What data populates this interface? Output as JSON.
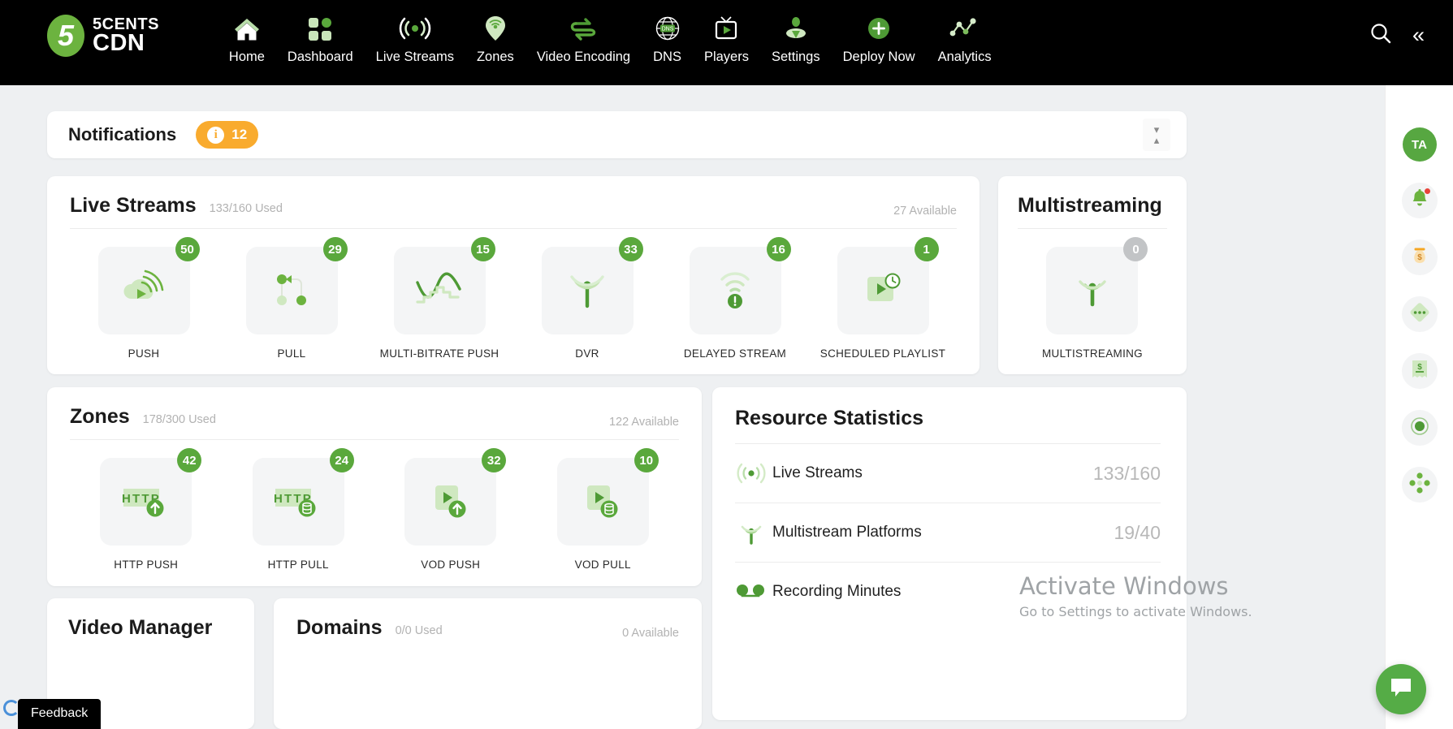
{
  "brand": {
    "mark": "5",
    "line1": "5CENTS",
    "line2": "CDN"
  },
  "nav": {
    "items": [
      {
        "label": "Home",
        "icon": "home-icon"
      },
      {
        "label": "Dashboard",
        "icon": "grid-icon"
      },
      {
        "label": "Live Streams",
        "icon": "broadcast-icon"
      },
      {
        "label": "Zones",
        "icon": "map-pin-wifi-icon"
      },
      {
        "label": "Video Encoding",
        "icon": "transcode-arrows-icon"
      },
      {
        "label": "DNS",
        "icon": "globe-dns-icon"
      },
      {
        "label": "Players",
        "icon": "tv-play-icon"
      },
      {
        "label": "Settings",
        "icon": "user-gear-icon"
      },
      {
        "label": "Deploy Now",
        "icon": "plus-circle-icon"
      },
      {
        "label": "Analytics",
        "icon": "line-chart-icon"
      }
    ],
    "search_icon": "search-icon",
    "collapse_icon": "double-chevron-left-icon",
    "collapse_glyph": "«"
  },
  "notifications": {
    "title": "Notifications",
    "count": "12",
    "info_glyph": "i"
  },
  "live_streams": {
    "title": "Live Streams",
    "used": "133/160 Used",
    "available": "27 Available",
    "tiles": [
      {
        "label": "PUSH",
        "count": "50",
        "icon": "cloud-upload-play-icon"
      },
      {
        "label": "PULL",
        "count": "29",
        "icon": "pull-nodes-icon"
      },
      {
        "label": "MULTI-BITRATE PUSH",
        "count": "15",
        "icon": "bitrate-wave-icon"
      },
      {
        "label": "DVR",
        "count": "33",
        "icon": "dvr-broadcast-icon"
      },
      {
        "label": "DELAYED STREAM",
        "count": "16",
        "icon": "delayed-wifi-alert-icon"
      },
      {
        "label": "SCHEDULED PLAYLIST",
        "count": "1",
        "icon": "play-clock-icon"
      }
    ]
  },
  "multistreaming": {
    "title": "Multistreaming",
    "tiles": [
      {
        "label": "MULTISTREAMING",
        "count": "0",
        "icon": "multistream-broadcast-icon"
      }
    ]
  },
  "zones": {
    "title": "Zones",
    "used": "178/300 Used",
    "available": "122 Available",
    "tiles": [
      {
        "label": "HTTP PUSH",
        "count": "42",
        "icon": "http-upload-icon"
      },
      {
        "label": "HTTP PULL",
        "count": "24",
        "icon": "http-database-icon"
      },
      {
        "label": "VOD PUSH",
        "count": "32",
        "icon": "vod-upload-icon"
      },
      {
        "label": "VOD PULL",
        "count": "10",
        "icon": "vod-database-icon"
      }
    ]
  },
  "resource_statistics": {
    "title": "Resource Statistics",
    "rows": [
      {
        "label": "Live Streams",
        "value": "133/160",
        "icon": "broadcast-icon"
      },
      {
        "label": "Multistream Platforms",
        "value": "19/40",
        "icon": "multistream-broadcast-icon"
      },
      {
        "label": "Recording Minutes",
        "value": "",
        "icon": "recording-link-icon"
      }
    ]
  },
  "video_manager": {
    "title": "Video Manager"
  },
  "domains": {
    "title": "Domains",
    "used": "0/0 Used",
    "available": "0 Available"
  },
  "rail": {
    "avatar": "TA",
    "items": [
      {
        "icon": "bell-icon",
        "badge": true
      },
      {
        "icon": "money-bag-icon",
        "badge": false
      },
      {
        "icon": "diamond-dots-icon",
        "badge": false
      },
      {
        "icon": "receipt-dollar-icon",
        "badge": false
      },
      {
        "icon": "record-target-icon",
        "badge": false
      },
      {
        "icon": "nodes-cluster-icon",
        "badge": false
      }
    ]
  },
  "watermark": {
    "line1": "Activate Windows",
    "line2": "Go to Settings to activate Windows."
  },
  "feedback": {
    "label": "Feedback"
  },
  "chat": {
    "icon": "chat-bubble-icon"
  },
  "colors": {
    "brand_green": "#6cb33f",
    "badge_green": "#5aa83c",
    "badge_gray": "#c2c4c6",
    "notif_orange": "#f9ab2e",
    "nav_black": "#000000",
    "page_bg": "#eef0f2"
  }
}
